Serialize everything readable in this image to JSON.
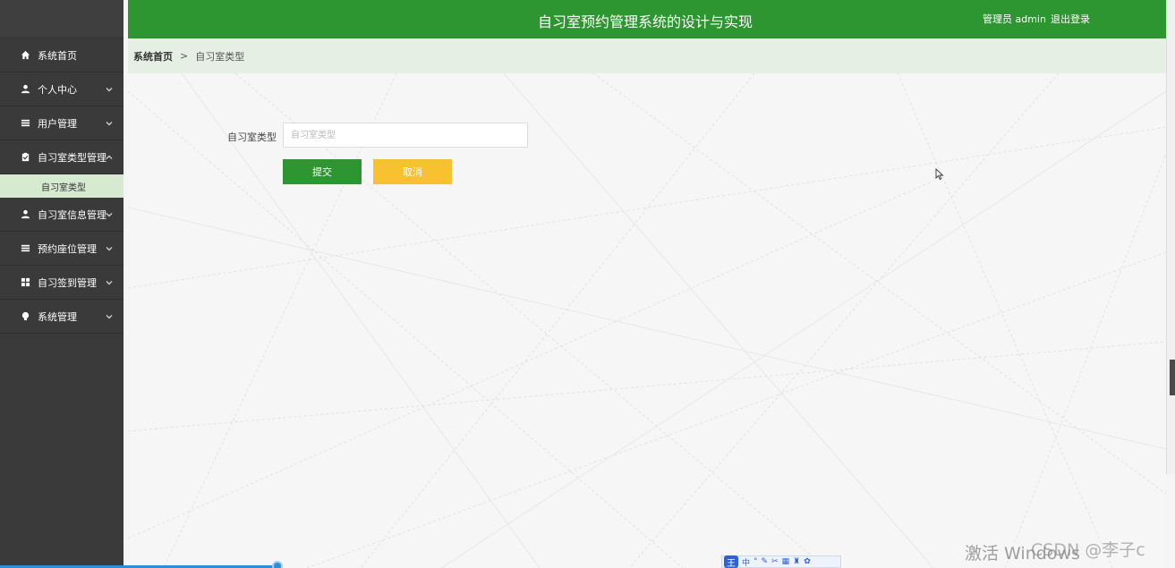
{
  "header": {
    "title": "自习室预约管理系统的设计与实现",
    "user": "管理员 admin",
    "logout": "退出登录"
  },
  "breadcrumb": {
    "home": "系统首页",
    "separator": ">",
    "current": "自习室类型"
  },
  "sidebar": {
    "items": [
      {
        "label": "系统首页",
        "icon": "home-icon"
      },
      {
        "label": "个人中心",
        "icon": "user-icon"
      },
      {
        "label": "用户管理",
        "icon": "list-icon"
      },
      {
        "label": "自习室类型管理",
        "icon": "clipboard-icon"
      },
      {
        "label": "自习室信息管理",
        "icon": "user-icon"
      },
      {
        "label": "预约座位管理",
        "icon": "list-icon"
      },
      {
        "label": "自习签到管理",
        "icon": "grid-icon"
      },
      {
        "label": "系统管理",
        "icon": "lightbulb-icon"
      }
    ],
    "subitem": "自习室类型"
  },
  "form": {
    "label": "自习室类型",
    "placeholder": "自习室类型",
    "value": "",
    "submit": "提交",
    "cancel": "取消"
  },
  "overlay": {
    "ime_logo": "王",
    "ime_mode": "中",
    "activate_watermark": "激活 Windows",
    "csdn_watermark": "CSDN @李子c"
  },
  "colors": {
    "primary": "#2d9631",
    "cancel": "#f7c12f",
    "sidebar": "#3a3a3a",
    "breadcrumb_bg": "#e6efe4",
    "subitem_bg": "#d6ead0"
  }
}
